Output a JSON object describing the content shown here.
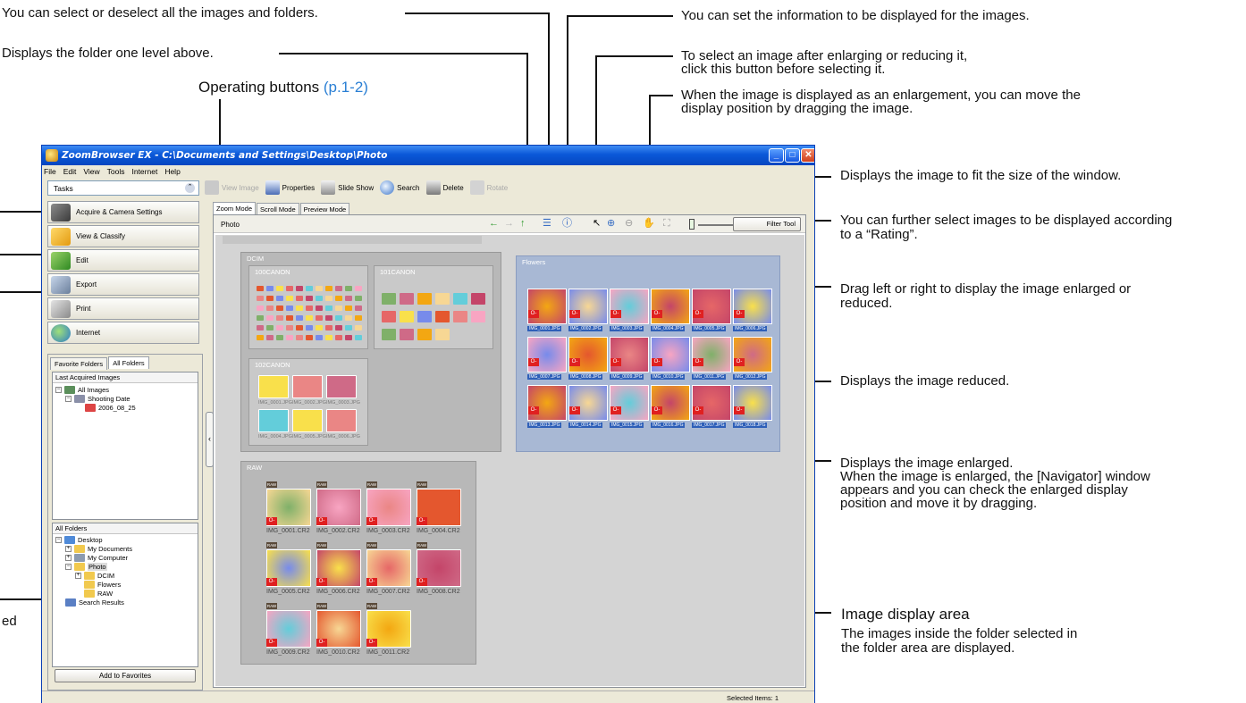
{
  "annotations": {
    "select_all": "You can select or deselect all the images and folders.",
    "up_level": "Displays the folder one level above.",
    "operating_buttons": "Operating buttons",
    "operating_buttons_ref": "(p.1-2)",
    "info_display": "You can set the information to be displayed for the images.",
    "select_mode_1": "To select an image after enlarging or reducing it,",
    "select_mode_2": "click this button before selecting it.",
    "hand_1": "When the image is displayed as an enlargement, you can move the",
    "hand_2": "display position by dragging the image.",
    "fit_window": "Displays the image to fit the size of the window.",
    "rating_1": "You can further select images to be displayed according",
    "rating_2": "to a “Rating”.",
    "drag_1": "Drag left or right to display the image enlarged or",
    "drag_2": "reduced.",
    "reduced": "Displays the image reduced.",
    "enlarged_1": "Displays the image enlarged.",
    "enlarged_2": "When the image is enlarged, the [Navigator] window",
    "enlarged_3": "appears and you can check the enlarged display",
    "enlarged_4": "position and move it by dragging.",
    "display_area_title": "Image display area",
    "display_area_1": "The images inside the folder selected in",
    "display_area_2": "the folder area are displayed.",
    "left_cut": "ed"
  },
  "window": {
    "title": "ZoomBrowser EX - C:\\Documents and Settings\\Desktop\\Photo",
    "min": "_",
    "max": "□",
    "close": "✕",
    "menu": [
      "File",
      "Edit",
      "View",
      "Tools",
      "Internet",
      "Help"
    ],
    "toolbar": {
      "view_image": "View Image",
      "properties": "Properties",
      "slide_show": "Slide Show",
      "search": "Search",
      "delete": "Delete",
      "rotate": "Rotate"
    },
    "tasks_label": "Tasks",
    "tasks_chev": "⌃",
    "task_buttons": [
      "Acquire & Camera Settings",
      "View & Classify",
      "Edit",
      "Export",
      "Print",
      "Internet"
    ],
    "folder_tabs": [
      "Favorite Folders",
      "All Folders"
    ],
    "last_acquired": {
      "header": "Last Acquired Images",
      "all_images": "All Images",
      "shooting_date": "Shooting Date",
      "date": "2006_08_25"
    },
    "all_folders": {
      "header": "All Folders",
      "desktop": "Desktop",
      "my_documents": "My Documents",
      "my_computer": "My Computer",
      "photo": "Photo",
      "dcim": "DCIM",
      "flowers": "Flowers",
      "raw": "RAW",
      "search_results": "Search Results"
    },
    "add_favorites": "Add to Favorites",
    "collapse": "‹",
    "mode_tabs": [
      "Zoom Mode",
      "Scroll Mode",
      "Preview Mode"
    ],
    "path_label": "Photo",
    "filter_tool": "Filter Tool",
    "groups": {
      "dcim": "DCIM",
      "c100": "100CANON",
      "c101": "101CANON",
      "c102": "102CANON",
      "raw": "RAW",
      "flowers": "Flowers"
    },
    "c102_labels": [
      "IMG_0001.JPG",
      "IMG_0002.JPG",
      "IMG_0003.JPG",
      "IMG_0004.JPG",
      "IMG_0005.JPG",
      "IMG_0006.JPG"
    ],
    "raw_files": [
      "IMG_0001.CR2",
      "IMG_0002.CR2",
      "IMG_0003.CR2",
      "IMG_0004.CR2",
      "IMG_0005.CR2",
      "IMG_0006.CR2",
      "IMG_0007.CR2",
      "IMG_0008.CR2",
      "IMG_0009.CR2",
      "IMG_0010.CR2",
      "IMG_0011.CR2"
    ],
    "flower_files": [
      "IMG_0001.JPG",
      "IMG_0002.JPG",
      "IMG_0003.JPG",
      "IMG_0004.JPG",
      "IMG_0005.JPG",
      "IMG_0006.JPG",
      "IMG_0007.JPG",
      "IMG_0008.JPG",
      "IMG_0009.JPG",
      "IMG_0010.JPG",
      "IMG_0011.JPG",
      "IMG_0012.JPG",
      "IMG_0013.JPG",
      "IMG_0014.JPG",
      "IMG_0015.JPG",
      "IMG_0016.JPG",
      "IMG_0017.JPG",
      "IMG_0018.JPG"
    ],
    "raw_tag": "RAW",
    "key_tag": "O-",
    "status": "Selected Items: 1"
  },
  "colors": {
    "titlebar": "#0a58d8",
    "link": "#2a7fd4",
    "flowers_bg": "#a8b8d4",
    "canvas_bg": "#d4d4d4"
  }
}
